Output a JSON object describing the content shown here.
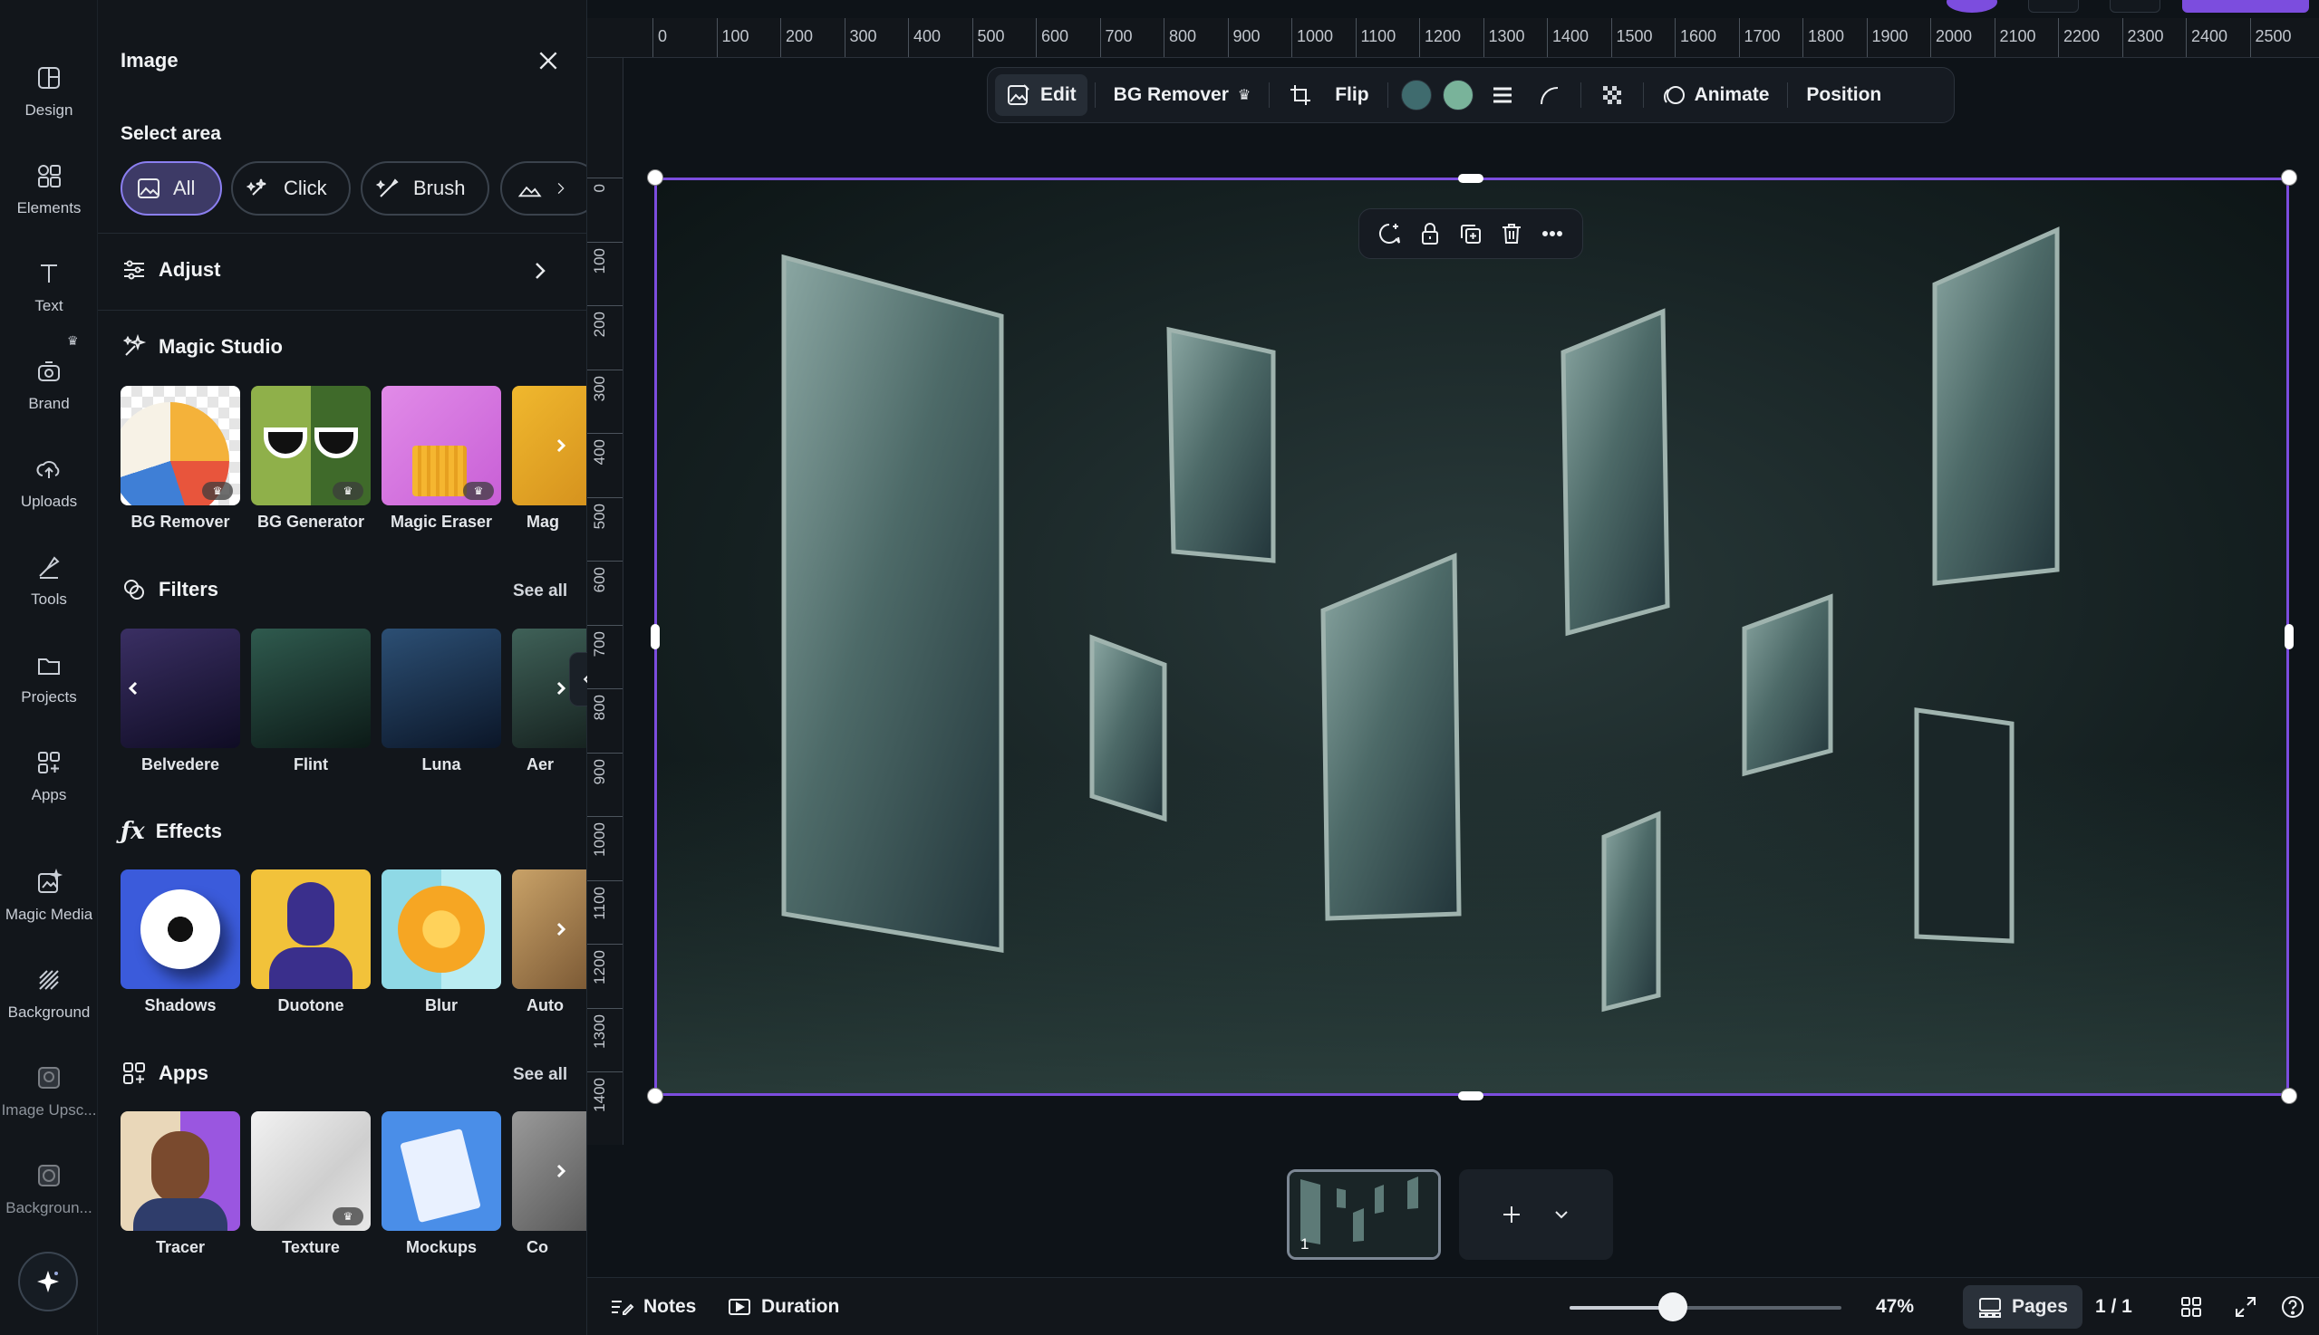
{
  "rail": {
    "items": [
      {
        "label": "Design",
        "icon": "design-icon"
      },
      {
        "label": "Elements",
        "icon": "elements-icon"
      },
      {
        "label": "Text",
        "icon": "text-icon"
      },
      {
        "label": "Brand",
        "icon": "brand-icon"
      },
      {
        "label": "Uploads",
        "icon": "uploads-icon"
      },
      {
        "label": "Tools",
        "icon": "tools-icon"
      },
      {
        "label": "Projects",
        "icon": "projects-icon"
      },
      {
        "label": "Apps",
        "icon": "apps-icon"
      },
      {
        "label": "Magic Media",
        "icon": "magic-media-icon"
      },
      {
        "label": "Background",
        "icon": "background-icon"
      },
      {
        "label": "Image Upsc...",
        "icon": "image-upscaler-icon"
      },
      {
        "label": "Backgroun...",
        "icon": "background-app-icon"
      }
    ]
  },
  "panel": {
    "title": "Image",
    "select_area": {
      "label": "Select area",
      "options": [
        "All",
        "Click",
        "Brush"
      ],
      "selected": "All"
    },
    "adjust": "Adjust",
    "magic_studio": {
      "title": "Magic Studio",
      "items": [
        "BG Remover",
        "BG Generator",
        "Magic Eraser",
        "Mag"
      ]
    },
    "filters": {
      "title": "Filters",
      "see_all": "See all",
      "items": [
        "Belvedere",
        "Flint",
        "Luna",
        "Aer"
      ]
    },
    "effects": {
      "title": "Effects",
      "items": [
        "Shadows",
        "Duotone",
        "Blur",
        "Auto"
      ]
    },
    "apps": {
      "title": "Apps",
      "see_all": "See all",
      "items": [
        "Tracer",
        "Texture",
        "Mockups",
        "Co"
      ]
    }
  },
  "ruler": {
    "top": [
      "0",
      "100",
      "200",
      "300",
      "400",
      "500",
      "600",
      "700",
      "800",
      "900",
      "1000",
      "1100",
      "1200",
      "1300",
      "1400",
      "1500",
      "1600",
      "1700",
      "1800",
      "1900",
      "2000",
      "2100",
      "2200",
      "2300",
      "2400",
      "2500"
    ],
    "left": [
      "0",
      "100",
      "200",
      "300",
      "400",
      "500",
      "600",
      "700",
      "800",
      "900",
      "1000",
      "1100",
      "1200",
      "1300",
      "1400"
    ]
  },
  "toolbar": {
    "edit": "Edit",
    "bg_remover": "BG Remover",
    "flip": "Flip",
    "animate": "Animate",
    "position": "Position",
    "swatches": [
      "#3f6b6e",
      "#79b39a"
    ]
  },
  "pages": {
    "current_page": "1"
  },
  "footer": {
    "notes": "Notes",
    "duration": "Duration",
    "zoom": "47%",
    "zoom_level": 0.38,
    "pages": "Pages",
    "page_count": "1 / 1"
  }
}
